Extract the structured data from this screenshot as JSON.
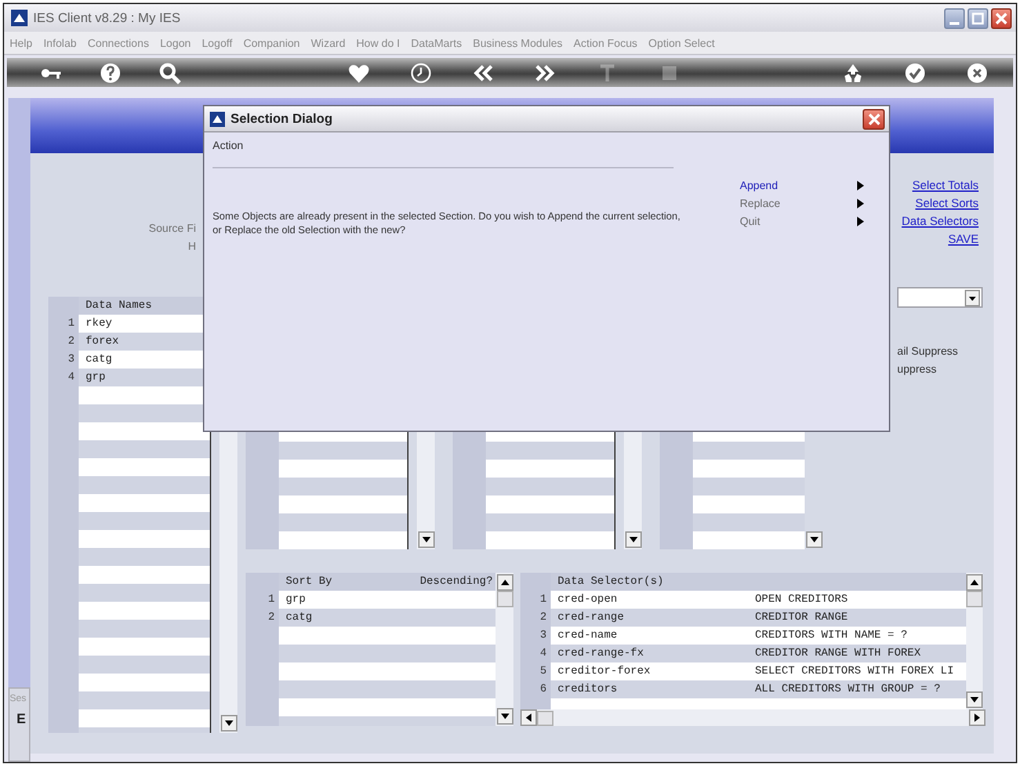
{
  "window": {
    "title": "IES Client v8.29 : My IES"
  },
  "menu": [
    {
      "label": "Help"
    },
    {
      "label": "Infolab"
    },
    {
      "label": "Connections"
    },
    {
      "label": "Logon"
    },
    {
      "label": "Logoff"
    },
    {
      "label": "Companion"
    },
    {
      "label": "Wizard"
    },
    {
      "label": "How do I"
    },
    {
      "label": "DataMarts"
    },
    {
      "label": "Business Modules"
    },
    {
      "label": "Action Focus"
    },
    {
      "label": "Option Select"
    }
  ],
  "toolbar_groups": [
    {
      "items": [
        {
          "kind": "key",
          "disabled": false
        },
        {
          "kind": "help",
          "disabled": false
        },
        {
          "kind": "search",
          "disabled": false
        }
      ]
    },
    {
      "items": [
        {
          "kind": "heart",
          "disabled": false
        },
        {
          "kind": "clock",
          "disabled": false
        },
        {
          "kind": "back",
          "disabled": false
        },
        {
          "kind": "forward",
          "disabled": false
        },
        {
          "kind": "text",
          "disabled": true
        },
        {
          "kind": "stop",
          "disabled": true
        }
      ]
    },
    {
      "items": [
        {
          "kind": "recycle",
          "disabled": false
        },
        {
          "kind": "check",
          "disabled": false
        },
        {
          "kind": "close",
          "disabled": false
        }
      ]
    }
  ],
  "form": {
    "labels": [
      "Source Fi",
      "H"
    ],
    "links": [
      "Select Totals",
      "Select Sorts",
      "Data Selectors",
      "SAVE"
    ],
    "suppress_labels": [
      "ail Suppress",
      "uppress"
    ],
    "data_names": {
      "header": "Data Names",
      "rows": [
        {
          "number": "1",
          "name": "rkey"
        },
        {
          "number": "2",
          "name": "forex"
        },
        {
          "number": "3",
          "name": "catg"
        },
        {
          "number": "4",
          "name": "grp"
        }
      ]
    },
    "sort_by": {
      "columns": [
        "Sort By",
        "Descending?"
      ],
      "rows": [
        {
          "number": "1",
          "field": "grp"
        },
        {
          "number": "2",
          "field": "catg"
        }
      ]
    },
    "data_selectors": {
      "header": "Data Selector(s)",
      "rows": [
        {
          "number": "1",
          "name": "cred-open",
          "description": "OPEN CREDITORS"
        },
        {
          "number": "2",
          "name": "cred-range",
          "description": "CREDITOR RANGE"
        },
        {
          "number": "3",
          "name": "cred-name",
          "description": "CREDITORS WITH NAME = ?"
        },
        {
          "number": "4",
          "name": "cred-range-fx",
          "description": "CREDITOR RANGE WITH FOREX"
        },
        {
          "number": "5",
          "name": "creditor-forex",
          "description": "SELECT CREDITORS WITH FOREX LI"
        },
        {
          "number": "6",
          "name": "creditors",
          "description": "ALL CREDITORS WITH GROUP = ?"
        }
      ]
    }
  },
  "side_panel": {
    "label": "Ses",
    "code": "E"
  },
  "dialog": {
    "title": "Selection Dialog",
    "section": "Action",
    "message": "Some Objects are already present in the selected Section. Do you wish to Append the current selection, or Replace the old Selection with the new?",
    "options": [
      {
        "label": "Append",
        "selected": true
      },
      {
        "label": "Replace",
        "selected": false
      },
      {
        "label": "Quit",
        "selected": false
      }
    ]
  }
}
